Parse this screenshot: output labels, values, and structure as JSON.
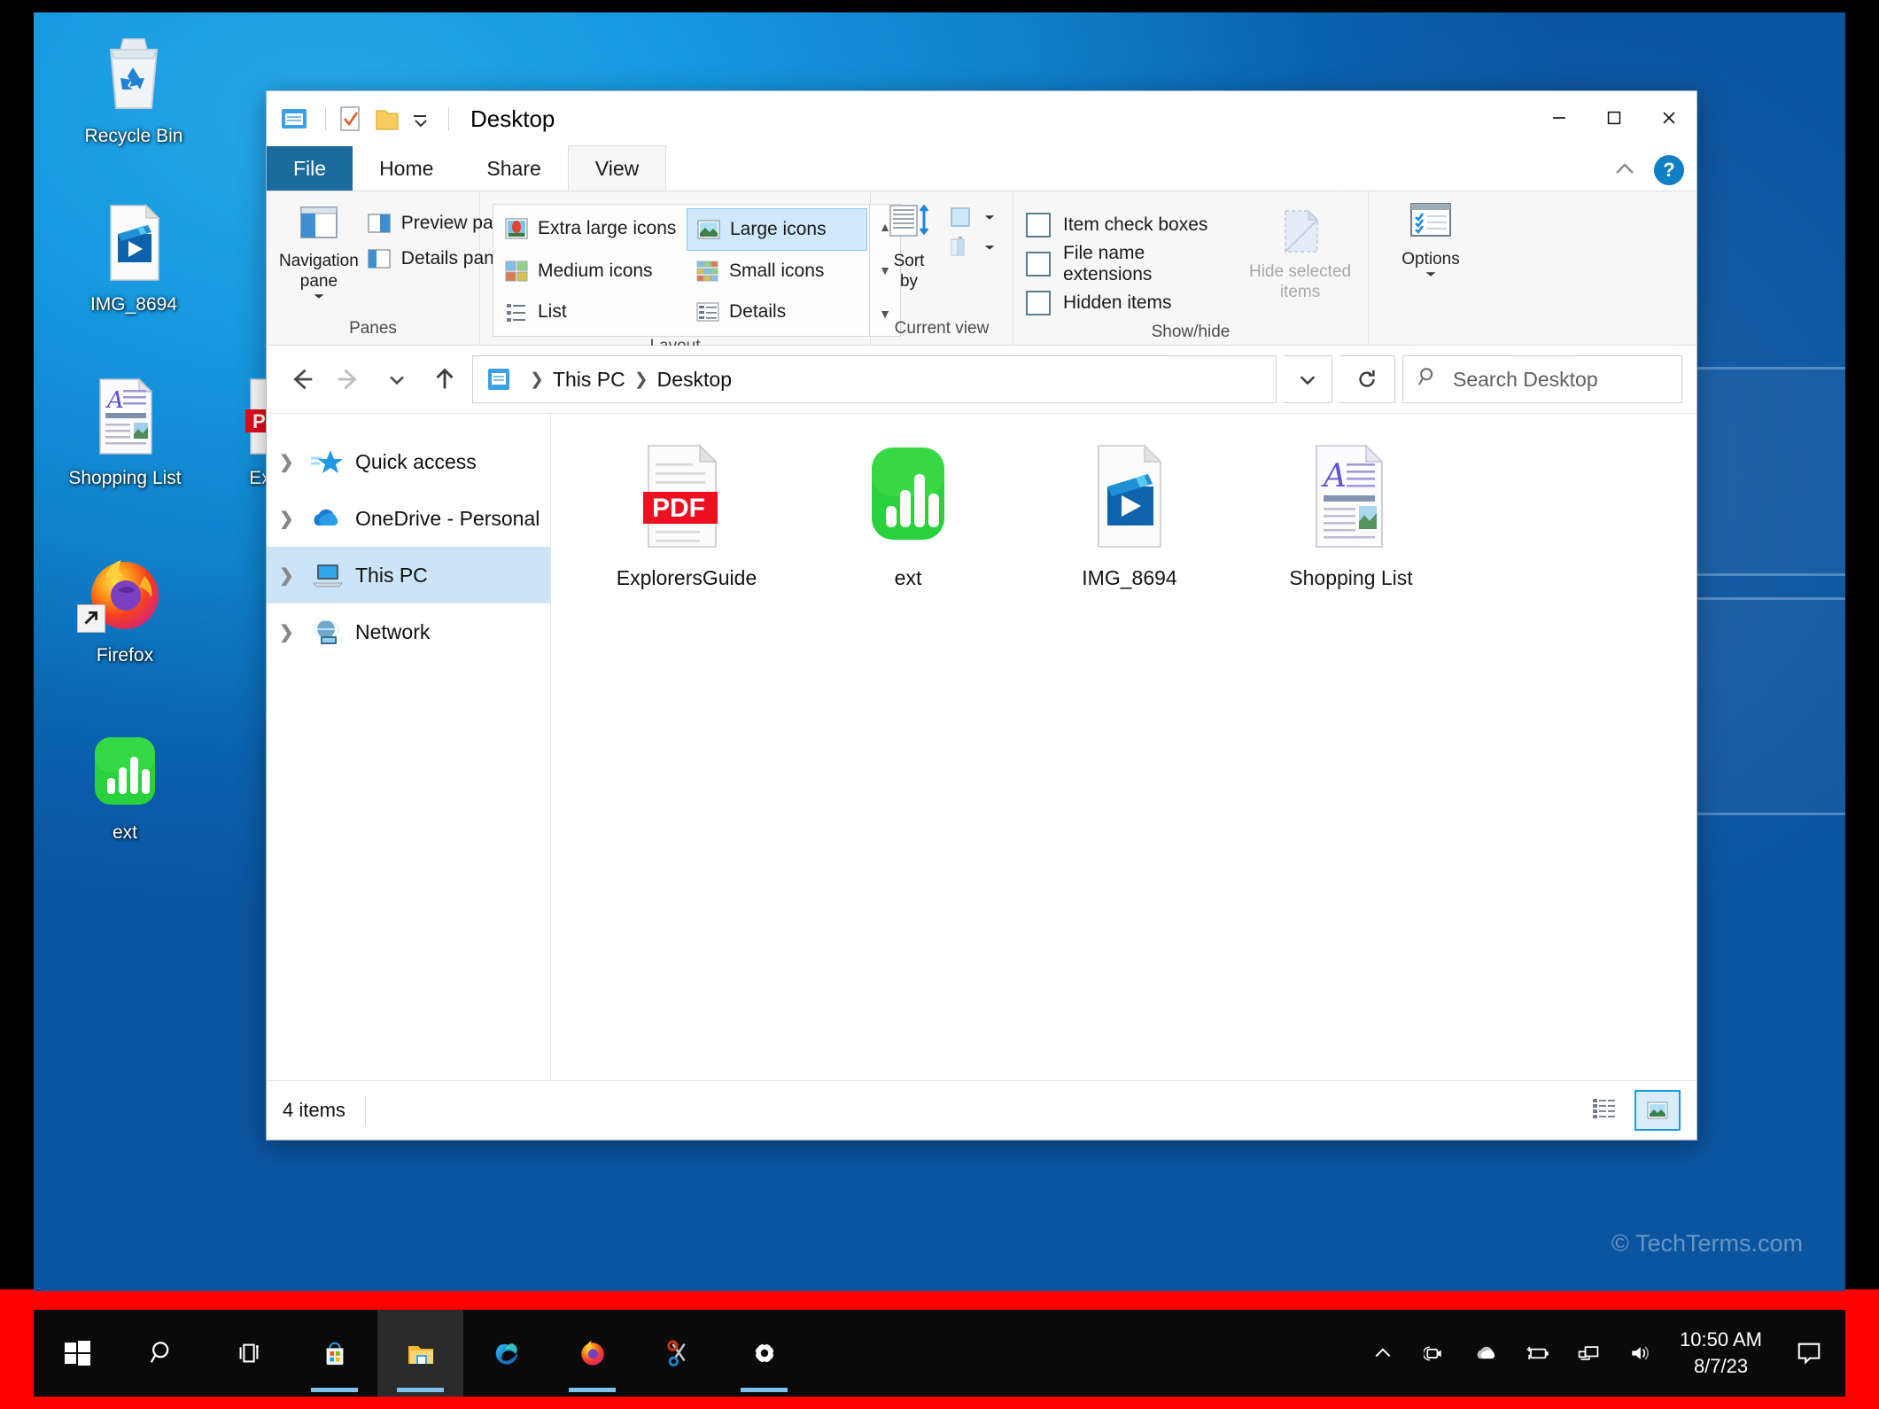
{
  "desktop": {
    "icons": [
      {
        "label": "Recycle Bin",
        "icon": "recycle-bin-icon"
      },
      {
        "label": "IMG_8694",
        "icon": "video-file-icon"
      },
      {
        "label": "Shopping List",
        "icon": "document-file-icon"
      },
      {
        "label": "Explor",
        "icon": "powerpoint-file-icon"
      },
      {
        "label": "Firefox",
        "icon": "firefox-icon"
      },
      {
        "label": "ext",
        "icon": "numbers-app-icon"
      }
    ],
    "watermark": "© TechTerms.com"
  },
  "window": {
    "title": "Desktop",
    "quick_access": [
      "explorer-icon",
      "properties-icon",
      "new-folder-icon",
      "customize-chevron-icon"
    ],
    "controls": {
      "minimize": "minimize-icon",
      "maximize": "maximize-icon",
      "close": "close-icon",
      "collapse_ribbon": "chevron-up-icon",
      "help": "?"
    },
    "tabs": [
      {
        "label": "File",
        "state": "file-menu"
      },
      {
        "label": "Home",
        "state": "inactive"
      },
      {
        "label": "Share",
        "state": "inactive"
      },
      {
        "label": "View",
        "state": "active"
      }
    ],
    "ribbon": {
      "groups": [
        {
          "label": "Panes",
          "big_buttons": [
            {
              "label": "Navigation pane",
              "icon": "navigation-pane-icon",
              "dropdown": true
            }
          ],
          "small_buttons": [
            {
              "label": "Preview pane",
              "icon": "preview-pane-icon"
            },
            {
              "label": "Details pane",
              "icon": "details-pane-icon"
            }
          ]
        },
        {
          "label": "Layout",
          "views": [
            {
              "label": "Extra large icons",
              "icon": "extra-large-icons-icon",
              "selected": false
            },
            {
              "label": "Large icons",
              "icon": "large-icons-icon",
              "selected": true
            },
            {
              "label": "Medium icons",
              "icon": "medium-icons-icon",
              "selected": false
            },
            {
              "label": "Small icons",
              "icon": "small-icons-icon",
              "selected": false
            },
            {
              "label": "List",
              "icon": "list-view-icon",
              "selected": false
            },
            {
              "label": "Details",
              "icon": "details-view-icon",
              "selected": false
            }
          ]
        },
        {
          "label": "Current view",
          "big_buttons": [
            {
              "label": "Sort by",
              "icon": "sort-by-icon",
              "dropdown": true
            }
          ],
          "small_buttons": [
            {
              "label": "",
              "icon": "add-columns-icon",
              "dropdown": true
            },
            {
              "label": "",
              "icon": "size-columns-icon",
              "dropdown": true
            }
          ]
        },
        {
          "label": "Show/hide",
          "checkboxes": [
            {
              "label": "Item check boxes",
              "checked": false
            },
            {
              "label": "File name extensions",
              "checked": false
            },
            {
              "label": "Hidden items",
              "checked": false
            }
          ],
          "big_buttons": [
            {
              "label": "Hide selected items",
              "icon": "hide-selected-items-icon",
              "disabled": true
            }
          ]
        },
        {
          "label": "",
          "big_buttons": [
            {
              "label": "Options",
              "icon": "options-icon",
              "dropdown": true
            }
          ]
        }
      ]
    },
    "address_bar": {
      "back": "back-arrow-icon",
      "forward": "forward-arrow-icon",
      "recent": "chevron-down-icon",
      "up": "up-arrow-icon",
      "breadcrumb": [
        "This PC",
        "Desktop"
      ],
      "breadcrumb_icon": "this-pc-folder-icon",
      "history_dropdown": "chevron-down-icon",
      "refresh": "refresh-icon",
      "search_placeholder": "Search Desktop",
      "search_value": "",
      "search_icon": "search-icon"
    },
    "nav_pane": [
      {
        "label": "Quick access",
        "icon": "quick-access-star-icon",
        "selected": false
      },
      {
        "label": "OneDrive - Personal",
        "icon": "onedrive-cloud-icon",
        "selected": false
      },
      {
        "label": "This PC",
        "icon": "this-pc-icon",
        "selected": true
      },
      {
        "label": "Network",
        "icon": "network-icon",
        "selected": false
      }
    ],
    "files": [
      {
        "name": "ExplorersGuide",
        "icon": "pdf-file-icon"
      },
      {
        "name": "ext",
        "icon": "numbers-app-icon"
      },
      {
        "name": "IMG_8694",
        "icon": "video-file-icon"
      },
      {
        "name": "Shopping List",
        "icon": "document-file-icon"
      }
    ],
    "status": {
      "item_count": "4 items",
      "view_buttons": [
        {
          "icon": "details-view-button-icon",
          "selected": false
        },
        {
          "icon": "large-icons-view-button-icon",
          "selected": true
        }
      ]
    }
  },
  "taskbar": {
    "buttons": [
      {
        "name": "start-button",
        "icon": "windows-logo-icon",
        "active": false,
        "running": false
      },
      {
        "name": "search-button",
        "icon": "search-icon",
        "active": false,
        "running": false
      },
      {
        "name": "task-view-button",
        "icon": "task-view-icon",
        "active": false,
        "running": false
      },
      {
        "name": "microsoft-store-button",
        "icon": "microsoft-store-icon",
        "active": false,
        "running": true
      },
      {
        "name": "file-explorer-button",
        "icon": "file-explorer-icon",
        "active": true,
        "running": true
      },
      {
        "name": "edge-button",
        "icon": "edge-icon",
        "active": false,
        "running": false
      },
      {
        "name": "firefox-button",
        "icon": "firefox-icon",
        "active": false,
        "running": true
      },
      {
        "name": "snipping-tool-button",
        "icon": "snipping-tool-icon",
        "active": false,
        "running": false
      },
      {
        "name": "settings-button",
        "icon": "settings-gear-icon",
        "active": false,
        "running": true
      }
    ],
    "tray": [
      {
        "name": "show-hidden-icons",
        "icon": "chevron-up-icon"
      },
      {
        "name": "camera-tray-icon",
        "icon": "camera-icon"
      },
      {
        "name": "onedrive-tray-icon",
        "icon": "cloud-icon"
      },
      {
        "name": "battery-tray-icon",
        "icon": "battery-charging-icon"
      },
      {
        "name": "network-tray-icon",
        "icon": "ethernet-icon"
      },
      {
        "name": "volume-tray-icon",
        "icon": "speaker-icon"
      }
    ],
    "clock": {
      "time": "10:50 AM",
      "date": "8/7/23"
    },
    "action_center": "notification-icon"
  }
}
